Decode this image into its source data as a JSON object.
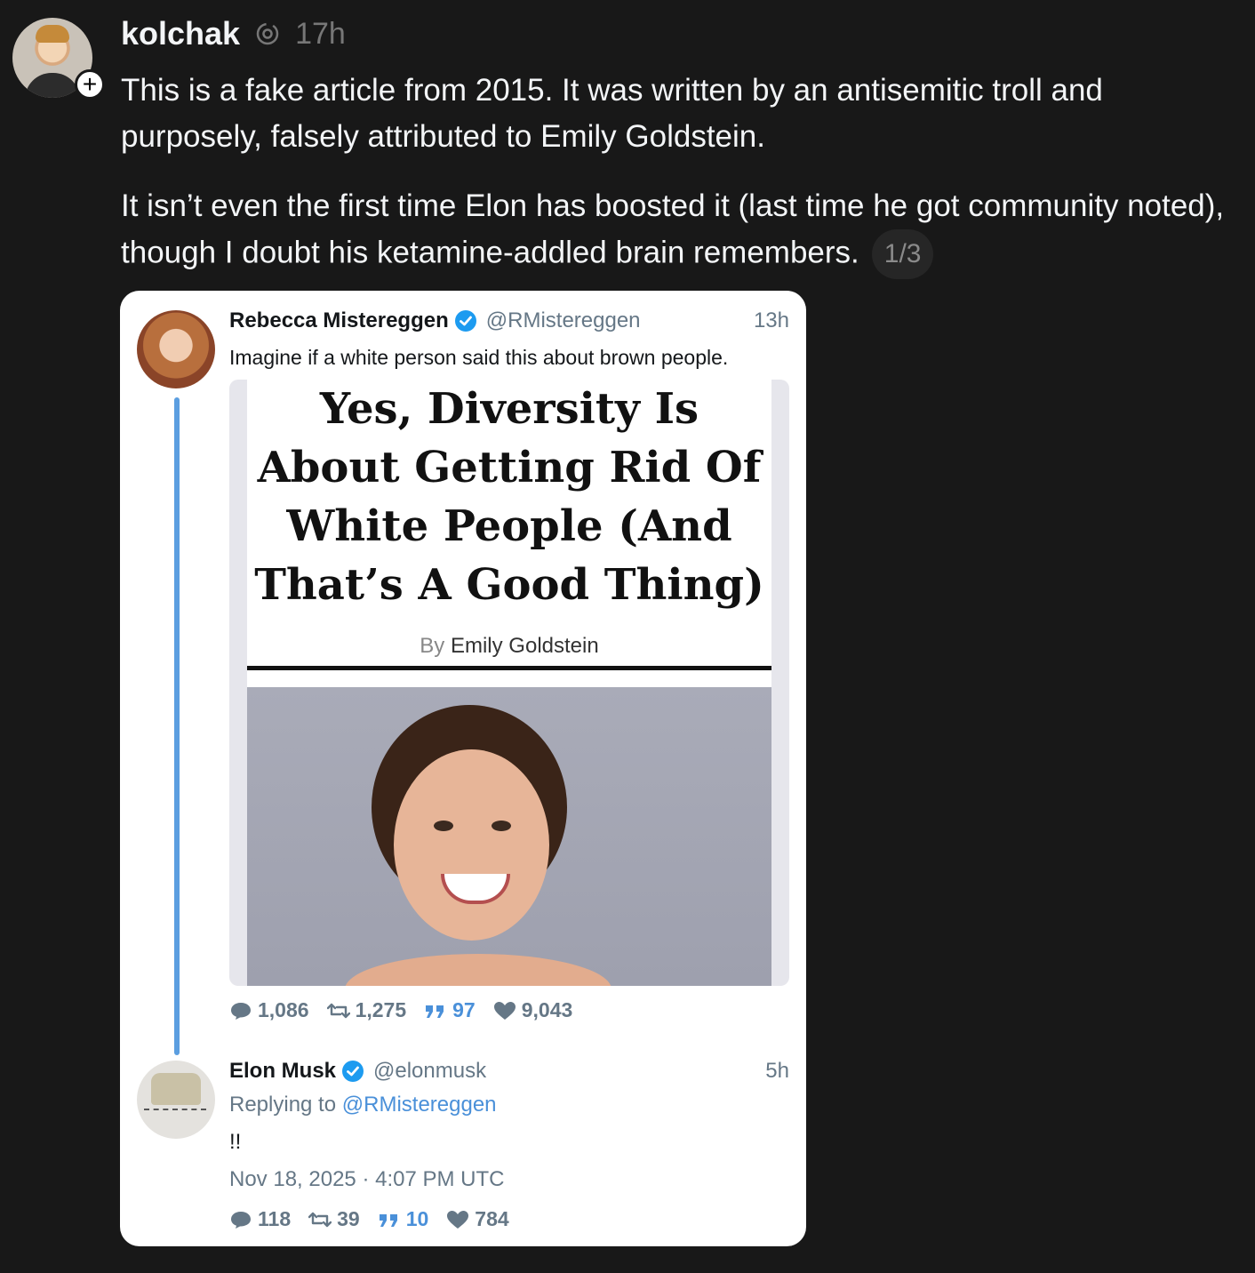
{
  "post": {
    "username": "kolchak",
    "time": "17h",
    "paragraph1": "This is a fake article from 2015. It was written by an antisemitic troll and purposely, falsely attributed to Emily Goldstein.",
    "paragraph2": "It isn’t even the first time Elon has boosted it (last time he got community noted), though I doubt his ketamine-addled brain remembers.",
    "page_indicator": "1/3",
    "follow_symbol": "+"
  },
  "embedded": {
    "tweet1": {
      "name": "Rebecca Mistereggen",
      "handle": "@RMistereggen",
      "time": "13h",
      "text": "Imagine if a white person said this about brown people.",
      "article": {
        "headline": "Yes, Diversity Is About Getting Rid Of White People (And That’s A Good Thing)",
        "byline_prefix": "By",
        "byline_author": "Emily Goldstein"
      },
      "stats": {
        "replies": "1,086",
        "retweets": "1,275",
        "quotes": "97",
        "likes": "9,043"
      }
    },
    "tweet2": {
      "name": "Elon Musk",
      "handle": "@elonmusk",
      "time": "5h",
      "replying_prefix": "Replying to",
      "replying_to": "@RMistereggen",
      "text": "!!",
      "date": "Nov 18, 2025 · 4:07 PM UTC",
      "stats": {
        "replies": "118",
        "retweets": "39",
        "quotes": "10",
        "likes": "784"
      }
    }
  },
  "colors": {
    "background": "#181818",
    "card": "#ffffff",
    "verified": "#1d9bf0",
    "thread_line": "#5b9ee0",
    "quote_accent": "#4a90d9"
  },
  "icons": [
    "threads-icon",
    "plus-icon",
    "verified-icon",
    "reply-icon",
    "retweet-icon",
    "quote-icon",
    "heart-icon"
  ]
}
